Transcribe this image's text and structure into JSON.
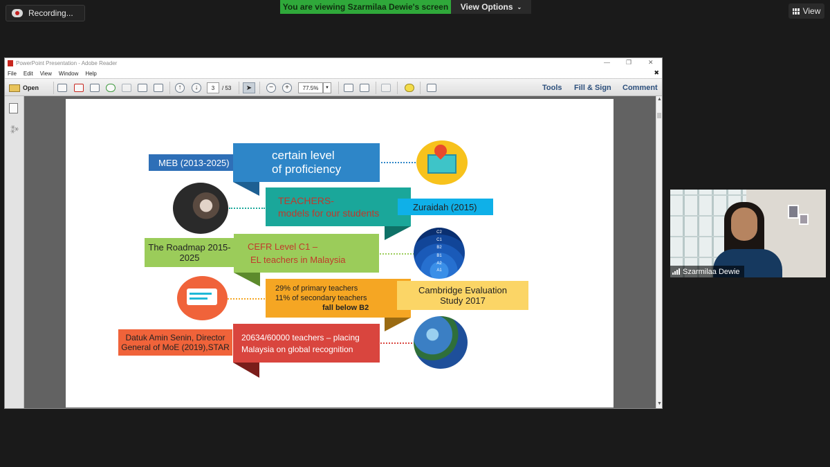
{
  "zoom": {
    "recording_label": "Recording...",
    "viewing_banner": "You are viewing Szarmilaa Dewie's screen",
    "view_options": "View Options",
    "view_button": "View",
    "participant_name": "Szarmilaa Dewie"
  },
  "reader": {
    "window_title": "PowerPoint Presentation - Adobe Reader",
    "menu": [
      "File",
      "Edit",
      "View",
      "Window",
      "Help"
    ],
    "toolbar": {
      "open": "Open",
      "page_current": "3",
      "page_total": "/ 53",
      "zoom_level": "77.5%",
      "tools": "Tools",
      "fill_sign": "Fill & Sign",
      "comment": "Comment"
    }
  },
  "slide": {
    "meb": "MEB (2013-2025)",
    "proficiency_line1": "certain level",
    "proficiency_line2": "of proficiency",
    "teachers_line1": "TEACHERS-",
    "teachers_line2": "models for our students",
    "zuraidah": "Zuraidah (2015)",
    "roadmap_line1": "The Roadmap 2015-",
    "roadmap_line2": "2025",
    "cefr_line1": "CEFR Level C1 –",
    "cefr_line2": "EL teachers in Malaysia",
    "stats_line1": "29% of primary teachers",
    "stats_line2": "11% of secondary teachers",
    "stats_line3": "fall below B2",
    "cambridge_line1": "Cambridge Evaluation",
    "cambridge_line2": "Study 2017",
    "datuk_line1": "Datuk Amin Senin, Director",
    "datuk_line2": "General of MoE (2019),STAR",
    "teachers_count_line1": "20634/60000 teachers – placing",
    "teachers_count_line2": "Malaysia on global recognition",
    "cefr_levels": [
      "C2",
      "C1",
      "B2",
      "B1",
      "A2",
      "A1"
    ]
  },
  "colors": {
    "blue": "#2e86c8",
    "teal": "#1aa79a",
    "green": "#9bcc5a",
    "orange": "#f5a623",
    "red": "#d9453e",
    "zoom_green": "#2fa83a"
  }
}
